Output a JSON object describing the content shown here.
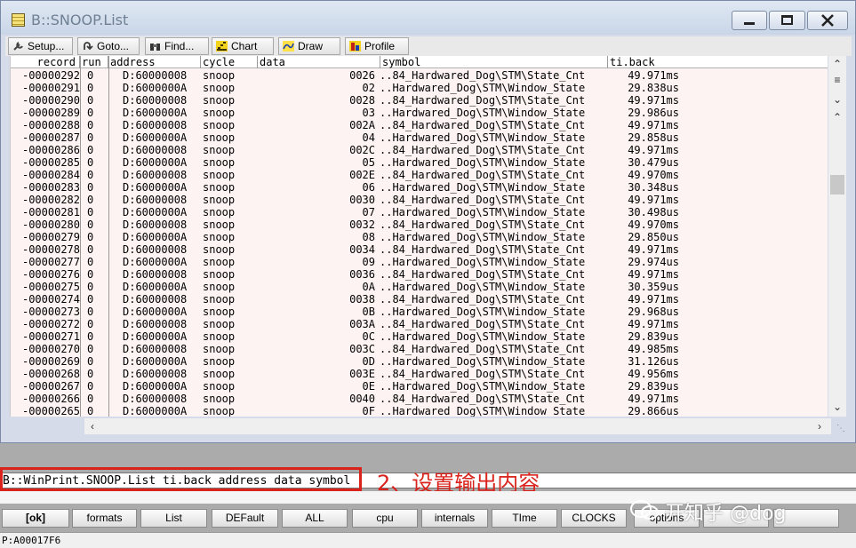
{
  "window": {
    "title": "B::SNOOP.List"
  },
  "toolbar": [
    {
      "label": "Setup...",
      "icon": "wrench-icon"
    },
    {
      "label": "Goto...",
      "icon": "goto-arrow-icon"
    },
    {
      "label": "Find...",
      "icon": "binoculars-icon"
    },
    {
      "label": "Chart",
      "icon": "chart-icon"
    },
    {
      "label": "Draw",
      "icon": "draw-icon"
    },
    {
      "label": "Profile",
      "icon": "profile-icon"
    }
  ],
  "columns": [
    "record",
    "run",
    "address",
    "cycle",
    "data",
    "symbol",
    "ti.back"
  ],
  "rows": [
    {
      "record": "-00000292",
      "run": "0",
      "address": "D:60000008",
      "cycle": "snoop",
      "data": "0026",
      "symbol": "..84_Hardwared_Dog\\STM\\State_Cnt",
      "ti_back": "49.971ms"
    },
    {
      "record": "-00000291",
      "run": "0",
      "address": "D:6000000A",
      "cycle": "snoop",
      "data": "02",
      "symbol": "..Hardwared_Dog\\STM\\Window_State",
      "ti_back": "29.838us"
    },
    {
      "record": "-00000290",
      "run": "0",
      "address": "D:60000008",
      "cycle": "snoop",
      "data": "0028",
      "symbol": "..84_Hardwared_Dog\\STM\\State_Cnt",
      "ti_back": "49.971ms"
    },
    {
      "record": "-00000289",
      "run": "0",
      "address": "D:6000000A",
      "cycle": "snoop",
      "data": "03",
      "symbol": "..Hardwared_Dog\\STM\\Window_State",
      "ti_back": "29.986us"
    },
    {
      "record": "-00000288",
      "run": "0",
      "address": "D:60000008",
      "cycle": "snoop",
      "data": "002A",
      "symbol": "..84_Hardwared_Dog\\STM\\State_Cnt",
      "ti_back": "49.971ms"
    },
    {
      "record": "-00000287",
      "run": "0",
      "address": "D:6000000A",
      "cycle": "snoop",
      "data": "04",
      "symbol": "..Hardwared_Dog\\STM\\Window_State",
      "ti_back": "29.858us"
    },
    {
      "record": "-00000286",
      "run": "0",
      "address": "D:60000008",
      "cycle": "snoop",
      "data": "002C",
      "symbol": "..84_Hardwared_Dog\\STM\\State_Cnt",
      "ti_back": "49.971ms"
    },
    {
      "record": "-00000285",
      "run": "0",
      "address": "D:6000000A",
      "cycle": "snoop",
      "data": "05",
      "symbol": "..Hardwared_Dog\\STM\\Window_State",
      "ti_back": "30.479us"
    },
    {
      "record": "-00000284",
      "run": "0",
      "address": "D:60000008",
      "cycle": "snoop",
      "data": "002E",
      "symbol": "..84_Hardwared_Dog\\STM\\State_Cnt",
      "ti_back": "49.970ms"
    },
    {
      "record": "-00000283",
      "run": "0",
      "address": "D:6000000A",
      "cycle": "snoop",
      "data": "06",
      "symbol": "..Hardwared_Dog\\STM\\Window_State",
      "ti_back": "30.348us"
    },
    {
      "record": "-00000282",
      "run": "0",
      "address": "D:60000008",
      "cycle": "snoop",
      "data": "0030",
      "symbol": "..84_Hardwared_Dog\\STM\\State_Cnt",
      "ti_back": "49.971ms"
    },
    {
      "record": "-00000281",
      "run": "0",
      "address": "D:6000000A",
      "cycle": "snoop",
      "data": "07",
      "symbol": "..Hardwared_Dog\\STM\\Window_State",
      "ti_back": "30.498us"
    },
    {
      "record": "-00000280",
      "run": "0",
      "address": "D:60000008",
      "cycle": "snoop",
      "data": "0032",
      "symbol": "..84_Hardwared_Dog\\STM\\State_Cnt",
      "ti_back": "49.970ms"
    },
    {
      "record": "-00000279",
      "run": "0",
      "address": "D:6000000A",
      "cycle": "snoop",
      "data": "08",
      "symbol": "..Hardwared_Dog\\STM\\Window_State",
      "ti_back": "29.850us"
    },
    {
      "record": "-00000278",
      "run": "0",
      "address": "D:60000008",
      "cycle": "snoop",
      "data": "0034",
      "symbol": "..84_Hardwared_Dog\\STM\\State_Cnt",
      "ti_back": "49.971ms"
    },
    {
      "record": "-00000277",
      "run": "0",
      "address": "D:6000000A",
      "cycle": "snoop",
      "data": "09",
      "symbol": "..Hardwared_Dog\\STM\\Window_State",
      "ti_back": "29.974us"
    },
    {
      "record": "-00000276",
      "run": "0",
      "address": "D:60000008",
      "cycle": "snoop",
      "data": "0036",
      "symbol": "..84_Hardwared_Dog\\STM\\State_Cnt",
      "ti_back": "49.971ms"
    },
    {
      "record": "-00000275",
      "run": "0",
      "address": "D:6000000A",
      "cycle": "snoop",
      "data": "0A",
      "symbol": "..Hardwared_Dog\\STM\\Window_State",
      "ti_back": "30.359us"
    },
    {
      "record": "-00000274",
      "run": "0",
      "address": "D:60000008",
      "cycle": "snoop",
      "data": "0038",
      "symbol": "..84_Hardwared_Dog\\STM\\State_Cnt",
      "ti_back": "49.971ms"
    },
    {
      "record": "-00000273",
      "run": "0",
      "address": "D:6000000A",
      "cycle": "snoop",
      "data": "0B",
      "symbol": "..Hardwared_Dog\\STM\\Window_State",
      "ti_back": "29.968us"
    },
    {
      "record": "-00000272",
      "run": "0",
      "address": "D:60000008",
      "cycle": "snoop",
      "data": "003A",
      "symbol": "..84_Hardwared_Dog\\STM\\State_Cnt",
      "ti_back": "49.971ms"
    },
    {
      "record": "-00000271",
      "run": "0",
      "address": "D:6000000A",
      "cycle": "snoop",
      "data": "0C",
      "symbol": "..Hardwared_Dog\\STM\\Window_State",
      "ti_back": "29.839us"
    },
    {
      "record": "-00000270",
      "run": "0",
      "address": "D:60000008",
      "cycle": "snoop",
      "data": "003C",
      "symbol": "..84_Hardwared_Dog\\STM\\State_Cnt",
      "ti_back": "49.985ms"
    },
    {
      "record": "-00000269",
      "run": "0",
      "address": "D:6000000A",
      "cycle": "snoop",
      "data": "0D",
      "symbol": "..Hardwared_Dog\\STM\\Window_State",
      "ti_back": "31.126us"
    },
    {
      "record": "-00000268",
      "run": "0",
      "address": "D:60000008",
      "cycle": "snoop",
      "data": "003E",
      "symbol": "..84_Hardwared_Dog\\STM\\State_Cnt",
      "ti_back": "49.956ms"
    },
    {
      "record": "-00000267",
      "run": "0",
      "address": "D:6000000A",
      "cycle": "snoop",
      "data": "0E",
      "symbol": "..Hardwared_Dog\\STM\\Window_State",
      "ti_back": "29.839us"
    },
    {
      "record": "-00000266",
      "run": "0",
      "address": "D:60000008",
      "cycle": "snoop",
      "data": "0040",
      "symbol": "..84_Hardwared_Dog\\STM\\State_Cnt",
      "ti_back": "49.971ms"
    },
    {
      "record": "-00000265",
      "run": "0",
      "address": "D:6000000A",
      "cycle": "snoop",
      "data": "0F",
      "symbol": "..Hardwared_Dog\\STM\\Window_State",
      "ti_back": "29.866us"
    }
  ],
  "command": {
    "prompt": "B::",
    "text": "WinPrint.SNOOP.List ti.back address data symbol"
  },
  "annotation": {
    "text": "2、设置输出内容",
    "color": "#d9231c"
  },
  "softkeys": [
    "[ok]",
    "formats",
    "List",
    "DEFault",
    "ALL",
    "cpu",
    "internals",
    "TIme",
    "CLOCKS",
    "options"
  ],
  "watermark": "开知乎 @dog",
  "status": "P:A00017F6"
}
